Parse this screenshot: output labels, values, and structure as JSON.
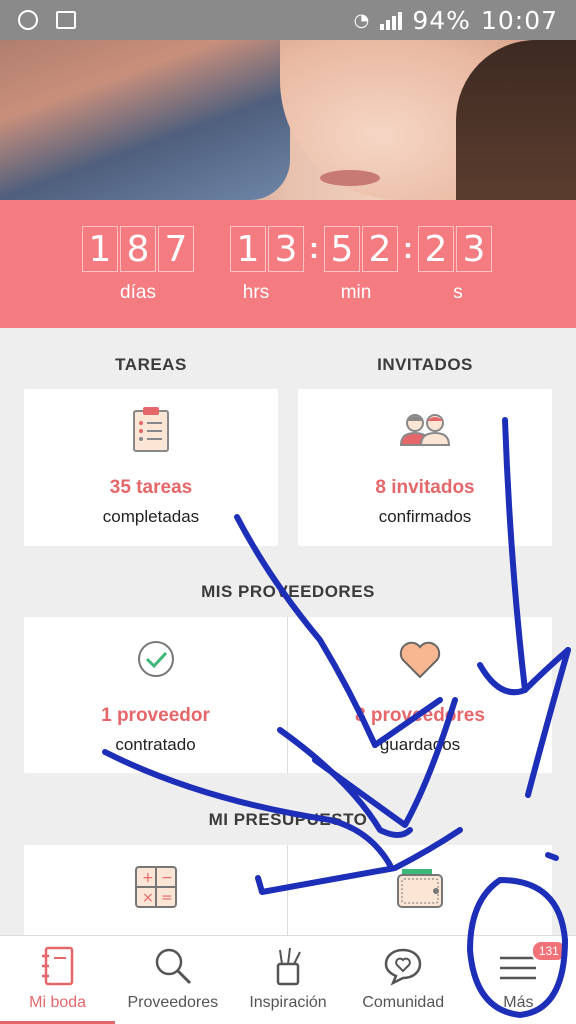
{
  "status_bar": {
    "battery": "94%",
    "time": "10:07"
  },
  "countdown": {
    "days": [
      "1",
      "8",
      "7"
    ],
    "hours": [
      "1",
      "3"
    ],
    "minutes": [
      "5",
      "2"
    ],
    "seconds": [
      "2",
      "3"
    ],
    "labels": {
      "days": "días",
      "hours": "hrs",
      "minutes": "min",
      "seconds": "s"
    }
  },
  "sections": {
    "tareas": "TAREAS",
    "invitados": "INVITADOS",
    "proveedores": "MIS PROVEEDORES",
    "presupuesto": "MI PRESUPUESTO"
  },
  "cards": {
    "tareas": {
      "title": "35 tareas",
      "sub": "completadas"
    },
    "invitados": {
      "title": "8 invitados",
      "sub": "confirmados"
    },
    "contratado": {
      "title": "1 proveedor",
      "sub": "contratado"
    },
    "guardados": {
      "title": "8 proveedores",
      "sub": "guardados"
    }
  },
  "nav": {
    "items": [
      {
        "label": "Mi boda",
        "icon": "notebook-icon"
      },
      {
        "label": "Proveedores",
        "icon": "search-icon"
      },
      {
        "label": "Inspiración",
        "icon": "tools-icon"
      },
      {
        "label": "Comunidad",
        "icon": "chat-heart-icon"
      },
      {
        "label": "Más",
        "icon": "menu-icon"
      }
    ],
    "badge": "131"
  },
  "colors": {
    "accent": "#f47b7f",
    "title_red": "#e5676a",
    "ink": "#1d2fb8"
  }
}
